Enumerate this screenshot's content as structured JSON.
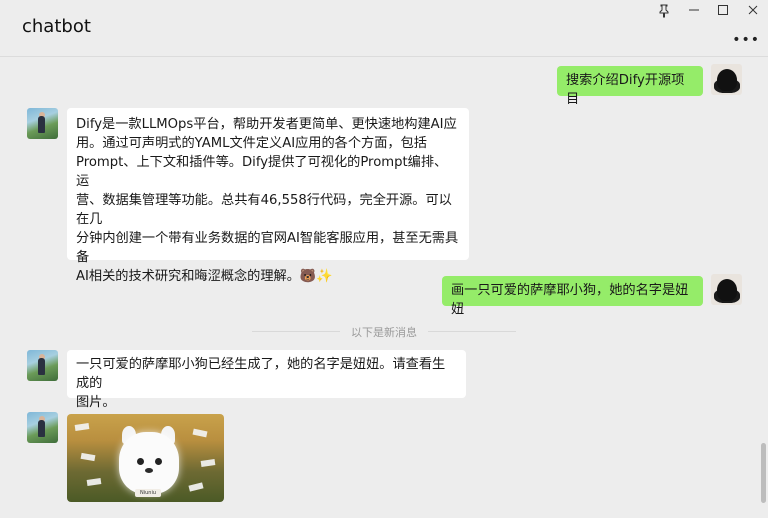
{
  "window": {
    "title": "chatbot",
    "pin_icon": "pin-icon",
    "minimize_icon": "minimize-icon",
    "maximize_icon": "maximize-icon",
    "close_icon": "close-icon",
    "more_icon": "more-options-icon"
  },
  "messages": [
    {
      "role": "user",
      "text": "搜索介绍Dify开源项目"
    },
    {
      "role": "bot",
      "lines": [
        "Dify是一款LLMOps平台，帮助开发者更简单、更快速地构建AI应",
        "用。通过可声明式的YAML文件定义AI应用的各个方面，包括",
        "Prompt、上下文和插件等。Dify提供了可视化的Prompt编排、运",
        "营、数据集管理等功能。总共有46,558行代码，完全开源。可以在几",
        "分钟内创建一个带有业务数据的官网AI智能客服应用，甚至无需具备",
        "AI相关的技术研究和晦涩概念的理解。🐻✨"
      ]
    },
    {
      "role": "user",
      "text": "画一只可爱的萨摩耶小狗，她的名字是妞妞"
    },
    {
      "role": "bot",
      "lines": [
        "一只可爱的萨摩耶小狗已经生成了，她的名字是妞妞。请查看生成的",
        "图片。"
      ]
    },
    {
      "role": "bot",
      "type": "image",
      "image_tag_text": "Niuniu"
    }
  ],
  "divider_text": "以下是新消息"
}
